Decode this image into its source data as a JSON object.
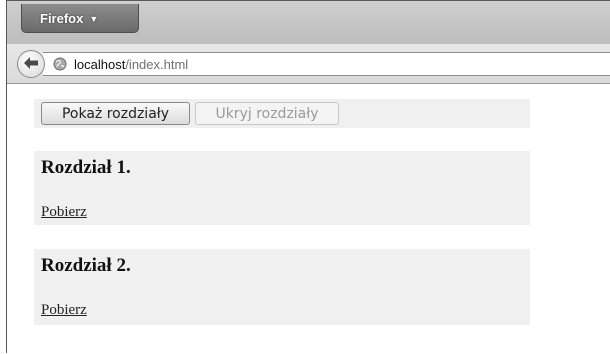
{
  "browser": {
    "menu_button_label": "Firefox",
    "url_host": "localhost",
    "url_path": "/index.html"
  },
  "page": {
    "show_button_label": "Pokaż rozdziały",
    "hide_button_label": "Ukryj rozdziały",
    "chapters": [
      {
        "title": "Rozdział 1.",
        "link_label": "Pobierz"
      },
      {
        "title": "Rozdział 2.",
        "link_label": "Pobierz"
      }
    ]
  },
  "colors": {
    "panel_background": "#f0f0f0",
    "chrome_background": "#dadada"
  },
  "icons": {
    "back": "arrow-left-icon",
    "site": "globe-icon",
    "menu_caret": "chevron-down-icon"
  }
}
